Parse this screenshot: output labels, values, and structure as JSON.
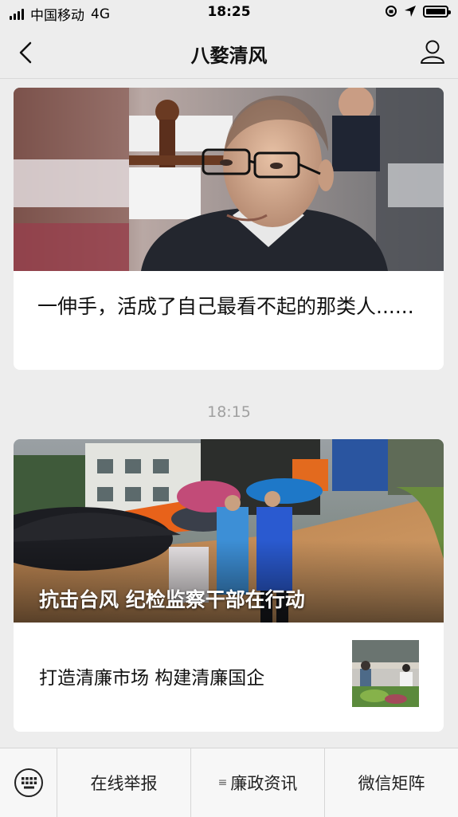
{
  "status_bar": {
    "carrier": "中国移动",
    "network": "4G",
    "time": "18:25"
  },
  "header": {
    "title": "八婺清风"
  },
  "articles": [
    {
      "title": "一伸手，活成了自己最看不起的那类人......",
      "image": "official-portrait-photo"
    }
  ],
  "divider_time": "18:15",
  "article_group": {
    "cover_caption": "抗击台风 纪检监察干部在行动",
    "cover_image": "typhoon-rescue-photo",
    "items": [
      {
        "title": "打造清廉市场 构建清廉国企",
        "thumb": "market-photo"
      }
    ]
  },
  "bottom_menu": {
    "keyboard_icon": "keyboard-icon",
    "items": [
      {
        "label": "在线举报",
        "has_submenu": false
      },
      {
        "label": "廉政资讯",
        "has_submenu": true
      },
      {
        "label": "微信矩阵",
        "has_submenu": false
      }
    ]
  }
}
